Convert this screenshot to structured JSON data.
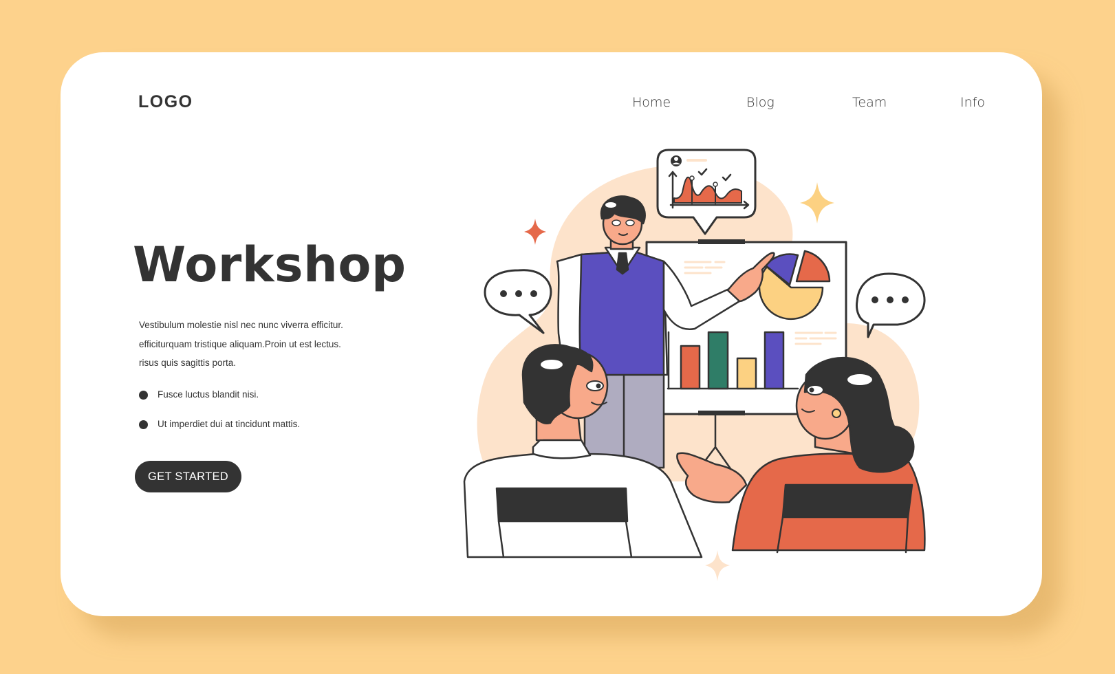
{
  "header": {
    "logo": "LOGO",
    "nav": [
      {
        "label": "Home"
      },
      {
        "label": "Blog"
      },
      {
        "label": "Team"
      },
      {
        "label": "Info"
      }
    ]
  },
  "hero": {
    "title": "Workshop",
    "description_lines": [
      "Vestibulum molestie nisl nec nunc viverra efficitur.",
      "efficiturquam tristique aliquam.Proin ut est lectus.",
      "risus quis sagittis porta."
    ],
    "bullets": [
      {
        "text": "Fusce luctus blandit nisi."
      },
      {
        "text": "Ut imperdiet dui at tincidunt mattis."
      }
    ],
    "cta_label": "GET STARTED"
  },
  "illustration": {
    "subject": "presenter pointing at pie chart on whiteboard, two attendees watching",
    "speech_bubbles": [
      "ellipsis-left",
      "ellipsis-right"
    ],
    "whiteboard_bar_chart_colors": [
      "#e5694a",
      "#2f7d67",
      "#fcd182",
      "#5b4fbf"
    ],
    "whiteboard_pie_colors": [
      "#fcd182",
      "#5b4fbf",
      "#e5694a"
    ],
    "popup_line_chart_fill": "#e5694a"
  },
  "colors": {
    "page_background": "#fdd28c",
    "card_background": "#ffffff",
    "text": "#333333",
    "button": "#333333",
    "button_text": "#ffffff",
    "accent_orange": "#e5694a",
    "accent_purple": "#5b4fbf",
    "accent_green": "#2f7d67",
    "accent_yellow": "#fcd182",
    "blob_peach": "#fde3cb"
  }
}
